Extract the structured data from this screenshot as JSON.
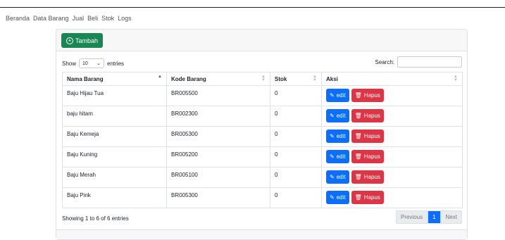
{
  "nav": [
    "Beranda",
    "Data Barang",
    "Jual",
    "Beli",
    "Stok",
    "Logs"
  ],
  "toolbar": {
    "tambah_label": "Tambah"
  },
  "controls": {
    "show_label": "Show",
    "entries_value": "10",
    "entries_label": "entries",
    "search_label": "Search:",
    "search_value": ""
  },
  "table": {
    "headers": [
      "Nama Barang",
      "Kode Barang",
      "Stok",
      "Aksi"
    ],
    "rows": [
      {
        "nama": "Baju Hijau Tua",
        "kode": "BR005500",
        "stok": "0"
      },
      {
        "nama": "baju hitam",
        "kode": "BR002300",
        "stok": "0"
      },
      {
        "nama": "Baju Kemeja",
        "kode": "BR005300",
        "stok": "0"
      },
      {
        "nama": "Baju Kuning",
        "kode": "BR005200",
        "stok": "0"
      },
      {
        "nama": "Baju Merah",
        "kode": "BR005100",
        "stok": "0"
      },
      {
        "nama": "Baju Pink",
        "kode": "BR005300",
        "stok": "0"
      }
    ],
    "edit_label": "edit",
    "hapus_label": "Hapus"
  },
  "footer": {
    "info": "Showing 1 to 6 of 6 entries",
    "previous": "Previous",
    "page": "1",
    "next": "Next"
  },
  "colors": {
    "primary": "#0d6efd",
    "danger": "#dc3545",
    "success": "#198754"
  },
  "icons": {
    "tambah": "plus-circle-icon",
    "edit": "pencil-icon",
    "hapus": "trash-icon",
    "select": "chevron-down-icon"
  }
}
